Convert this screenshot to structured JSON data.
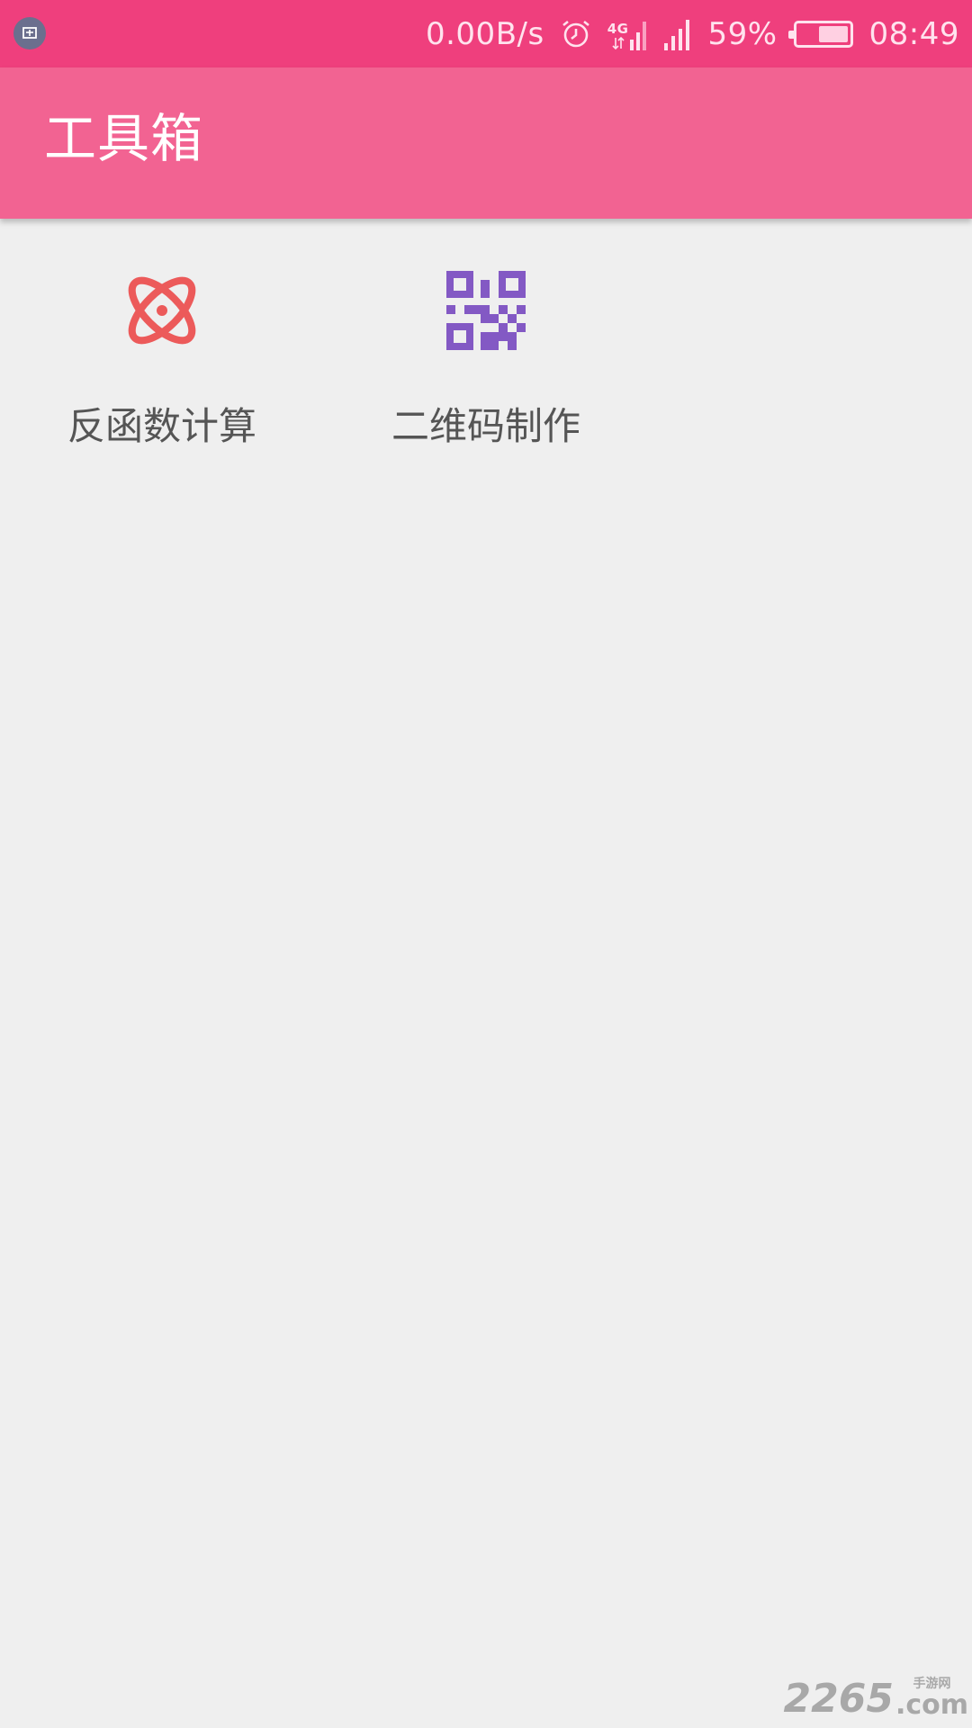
{
  "status_bar": {
    "network_speed": "0.00B/s",
    "network_type": "4G",
    "battery_percent": "59%",
    "battery_level": 0.59,
    "time": "08:49",
    "icons": [
      "screenshot-icon",
      "alarm-icon",
      "4g-signal-icon",
      "cell-signal-icon",
      "battery-icon"
    ]
  },
  "app_bar": {
    "title": "工具箱"
  },
  "tools": [
    {
      "label": "反函数计算",
      "icon": "atom-icon",
      "color": "#ec5a5a"
    },
    {
      "label": "二维码制作",
      "icon": "qr-code-icon",
      "color": "#8359c4"
    }
  ],
  "watermark": {
    "number": "2265",
    "cn_text": "手游网",
    "domain": ".com"
  },
  "colors": {
    "status_bar": "#ef3f7d",
    "app_bar": "#f26392",
    "background": "#efefef"
  }
}
